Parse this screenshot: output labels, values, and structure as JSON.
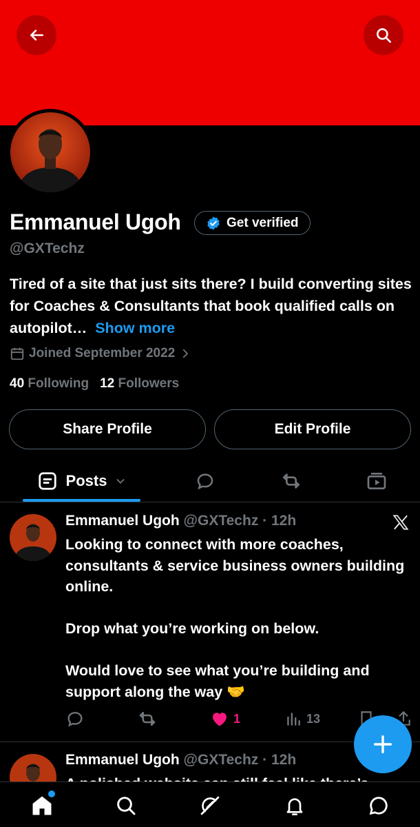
{
  "profile": {
    "name": "Emmanuel Ugoh",
    "handle": "@GXTechz",
    "verify_label": "Get verified",
    "bio_text": "Tired of a site that just sits there? I build converting sites for Coaches & Consultants that book qualified calls on autopilot…",
    "bio_more": "Show more",
    "joined": "Joined September 2022",
    "following_count": "40",
    "following_label": "Following",
    "followers_count": "12",
    "followers_label": "Followers",
    "share_label": "Share Profile",
    "edit_label": "Edit Profile"
  },
  "tabs": {
    "posts_label": "Posts"
  },
  "posts": [
    {
      "name": "Emmanuel Ugoh",
      "meta": "@GXTechz · 12h",
      "text": "Looking to connect with more coaches, consultants & service business owners building online.\n\nDrop what you’re working on below.\n\nWould love to see what you’re building and support along the way 🤝",
      "likes": "1",
      "views": "13"
    },
    {
      "name": "Emmanuel Ugoh",
      "meta": "@GXTechz · 12h",
      "text_partial": "A polished website can still feel like there’s"
    }
  ],
  "colors": {
    "banner": "#ef0000",
    "accent": "#1d9bf0",
    "like": "#f91880",
    "muted": "#71767b"
  },
  "icons": [
    "back-arrow-icon",
    "search-icon",
    "verified-badge-icon",
    "calendar-icon",
    "chevron-right-icon",
    "posts-tab-icon",
    "chevron-down-icon",
    "reply-icon",
    "repost-icon",
    "media-icon",
    "x-logo-icon",
    "heart-icon",
    "views-icon",
    "bookmark-icon",
    "share-icon",
    "plus-icon",
    "home-icon",
    "grok-icon",
    "bell-icon",
    "chat-icon"
  ]
}
